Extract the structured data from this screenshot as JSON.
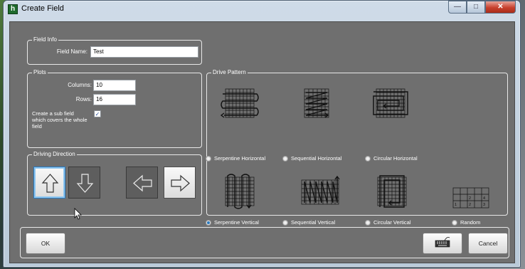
{
  "window": {
    "title": "Create Field",
    "app_icon_letter": "h"
  },
  "field_info": {
    "legend": "Field Info",
    "name_label": "Field Name:",
    "name_value": "Test"
  },
  "plots": {
    "legend": "Plots",
    "columns_label": "Columns:",
    "columns_value": "10",
    "rows_label": "Rows:",
    "rows_value": "16",
    "subfield_label": "Create a sub field which covers the whole field",
    "subfield_checked": true
  },
  "driving_direction": {
    "legend": "Driving Direction",
    "selected": "up"
  },
  "drive_pattern": {
    "legend": "Drive Pattern",
    "options": [
      {
        "label": "Serpentine Horizontal",
        "selected": false
      },
      {
        "label": "Sequential Horizontal",
        "selected": false
      },
      {
        "label": "Circular Horizontal",
        "selected": false
      },
      {
        "label": "Serpentine Vertical",
        "selected": true
      },
      {
        "label": "Sequential Vertical",
        "selected": false
      },
      {
        "label": "Circular Vertical",
        "selected": false
      },
      {
        "label": "Random",
        "selected": false
      }
    ],
    "random_numbers": [
      "2",
      "4",
      "1",
      "2",
      "3"
    ]
  },
  "buttons": {
    "ok": "OK",
    "cancel": "Cancel"
  },
  "colors": {
    "panel_bg": "#6f6f6f",
    "accent": "#2a7abf",
    "close_red": "#c7402d"
  }
}
